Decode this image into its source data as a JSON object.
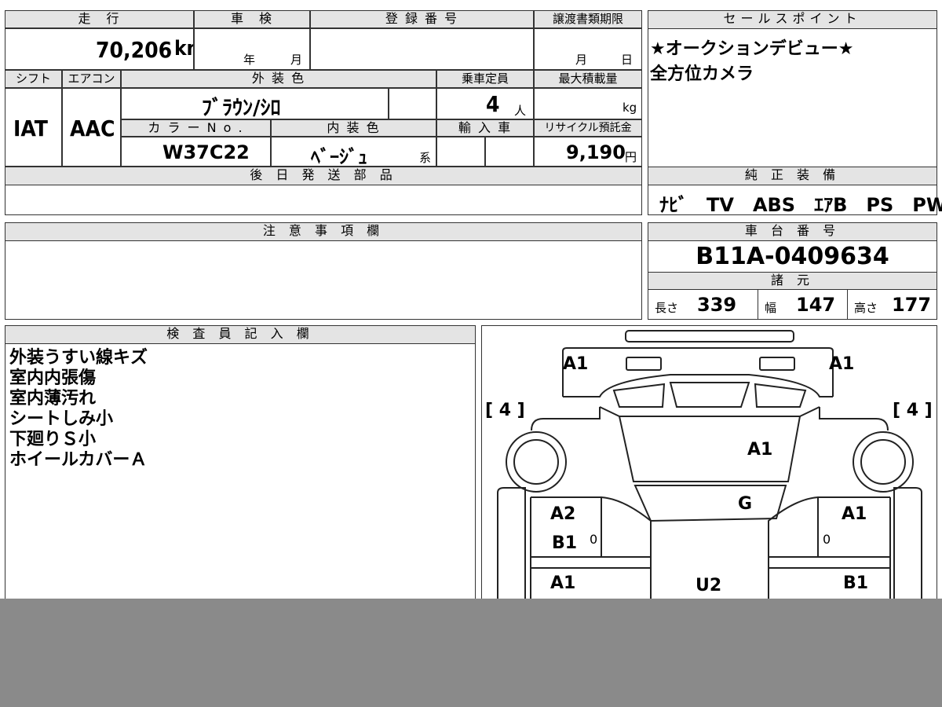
{
  "top_row": {
    "mileage_header": "走　行",
    "shaken_header": "車　検",
    "registration_header": "登 録 番 号",
    "transfer_deadline_header": "譲渡書類期限",
    "mileage_value": "70,206",
    "mileage_unit": "km",
    "shaken_year_unit": "年",
    "shaken_month_unit": "月",
    "transfer_month_unit": "月",
    "transfer_day_unit": "日"
  },
  "second_row": {
    "shift_header": "シフト",
    "ac_header": "エアコン",
    "exterior_color_header": "外 装 色",
    "capacity_header": "乗車定員",
    "max_load_header": "最大積載量",
    "shift_value": "IAT",
    "ac_value": "AAC",
    "exterior_color_value": "ﾌﾞﾗｳﾝ/ｼﾛ",
    "capacity_value": "4",
    "capacity_unit": "人",
    "max_load_unit": "kg"
  },
  "third_row": {
    "color_no_header": "カ ラ ー N o .",
    "interior_color_header": "内 装 色",
    "import_header": "輸 入 車",
    "recycle_header": "リサイクル預託金",
    "color_no_value": "W37C22",
    "interior_color_value": "ﾍﾞｰｼﾞｭ",
    "interior_color_suffix": "系",
    "recycle_value": "9,190",
    "recycle_unit": "円"
  },
  "parts_later": {
    "header": "後 日 発 送 部 品"
  },
  "sales_points": {
    "header": "セールスポイント",
    "lines": [
      "★オークションデビュー★",
      "全方位カメラ"
    ]
  },
  "genuine_equipment": {
    "header": "純 正 装 備",
    "value": "ﾅﾋﾞ　TV　ABS　ｴｱB　PS　PW"
  },
  "notes": {
    "header": "注 意 事 項 欄"
  },
  "chassis": {
    "header": "車 台 番 号",
    "value": "B11A-0409634",
    "specs_header": "諸 元",
    "length_label": "長さ",
    "length_value": "339",
    "width_label": "幅",
    "width_value": "147",
    "height_label": "高さ",
    "height_value": "177"
  },
  "inspector": {
    "header": "検 査 員 記 入 欄",
    "lines": [
      "外装うすい線キズ",
      "室内内張傷",
      "室内薄汚れ",
      "シートしみ小",
      "下廻りＳ小",
      "ホイールカバーＡ"
    ]
  },
  "diagram": {
    "labels": {
      "front_left": "A1",
      "front_right": "A1",
      "tire_left": "[ 4 ]",
      "tire_right": "[ 4 ]",
      "hood": "A1",
      "windshield": "G",
      "left_front_door_a": "A2",
      "left_front_door_b": "B1",
      "right_front_door": "A1",
      "left_rear_door": "A1",
      "roof": "U2",
      "right_rear_door": "B1",
      "zero_left": "0",
      "zero_right": "0"
    }
  }
}
